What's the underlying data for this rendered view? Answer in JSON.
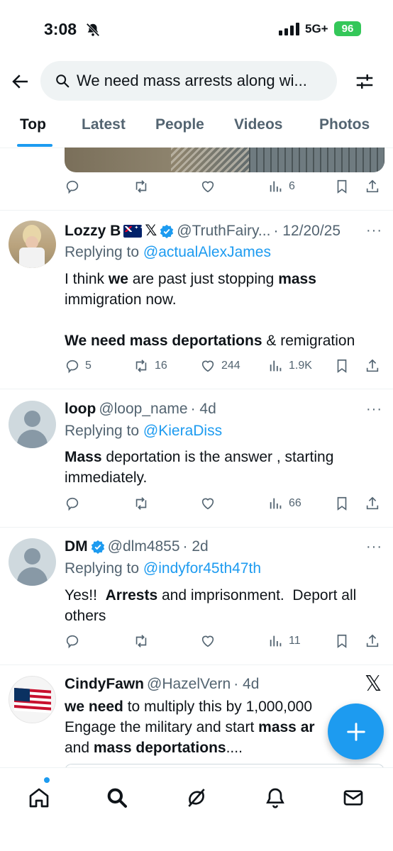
{
  "status_bar": {
    "time": "3:08",
    "network": "5G+",
    "battery": "96",
    "icons": [
      "bell-off-icon",
      "signal-icon",
      "battery-icon"
    ]
  },
  "search": {
    "query": "We need mass arrests along wi..."
  },
  "tabs": [
    {
      "label": "Top",
      "active": true
    },
    {
      "label": "Latest",
      "active": false
    },
    {
      "label": "People",
      "active": false
    },
    {
      "label": "Videos",
      "active": false
    },
    {
      "label": "Photos",
      "active": false
    }
  ],
  "top_tweet_partial": {
    "views": "6"
  },
  "tweets": [
    {
      "name": "Lozzy B",
      "handle": "@TruthFairy...",
      "time": "· 12/20/25",
      "replying_label": "Replying to",
      "replying_to": "@actualAlexJames",
      "text_parts": [
        {
          "t": "I think ",
          "b": false
        },
        {
          "t": "we",
          "b": true
        },
        {
          "t": " are past just stopping ",
          "b": false
        },
        {
          "t": "mass",
          "b": true
        },
        {
          "t": " immigration now.",
          "b": false
        }
      ],
      "text_parts_2": [
        {
          "t": "We need mass deportations",
          "b": true
        },
        {
          "t": " & remigration",
          "b": false
        }
      ],
      "replies": "5",
      "retweets": "16",
      "likes": "244",
      "views": "1.9K"
    },
    {
      "name": "loop",
      "handle": "@loop_name",
      "time": "· 4d",
      "replying_label": "Replying to",
      "replying_to": "@KieraDiss",
      "text_parts": [
        {
          "t": "Mass",
          "b": true
        },
        {
          "t": " deportation is the answer , starting immediately.",
          "b": false
        }
      ],
      "replies": "",
      "retweets": "",
      "likes": "",
      "views": "66"
    },
    {
      "name": "DM",
      "handle": "@dlm4855",
      "time": "· 2d",
      "replying_label": "Replying to",
      "replying_to": "@indyfor45th47th",
      "text_parts": [
        {
          "t": "Yes!!  ",
          "b": false
        },
        {
          "t": "Arrests",
          "b": true
        },
        {
          "t": " and imprisonment.  Deport all others",
          "b": false
        }
      ],
      "replies": "",
      "retweets": "",
      "likes": "",
      "views": "11"
    },
    {
      "name": "CindyFawn",
      "handle": "@HazelVern",
      "time": "· 4d",
      "text_parts": [
        {
          "t": "we need",
          "b": true
        },
        {
          "t": " to multiply this by 1,000,000",
          "b": false
        }
      ],
      "text_parts_2": [
        {
          "t": "Engage the military and start ",
          "b": false
        },
        {
          "t": "mass ar",
          "b": true
        }
      ],
      "text_parts_3": [
        {
          "t": "and ",
          "b": false
        },
        {
          "t": "mass deportations",
          "b": true
        },
        {
          "t": "....",
          "b": false
        }
      ]
    }
  ],
  "more_label": "···",
  "close_label": "𝕏",
  "colors": {
    "accent": "#1d9bf0",
    "text": "#0f1419",
    "muted": "#536471",
    "battery": "#34c759"
  },
  "bottom_nav": [
    "home-icon",
    "search-icon",
    "grok-icon",
    "notifications-icon",
    "messages-icon"
  ]
}
